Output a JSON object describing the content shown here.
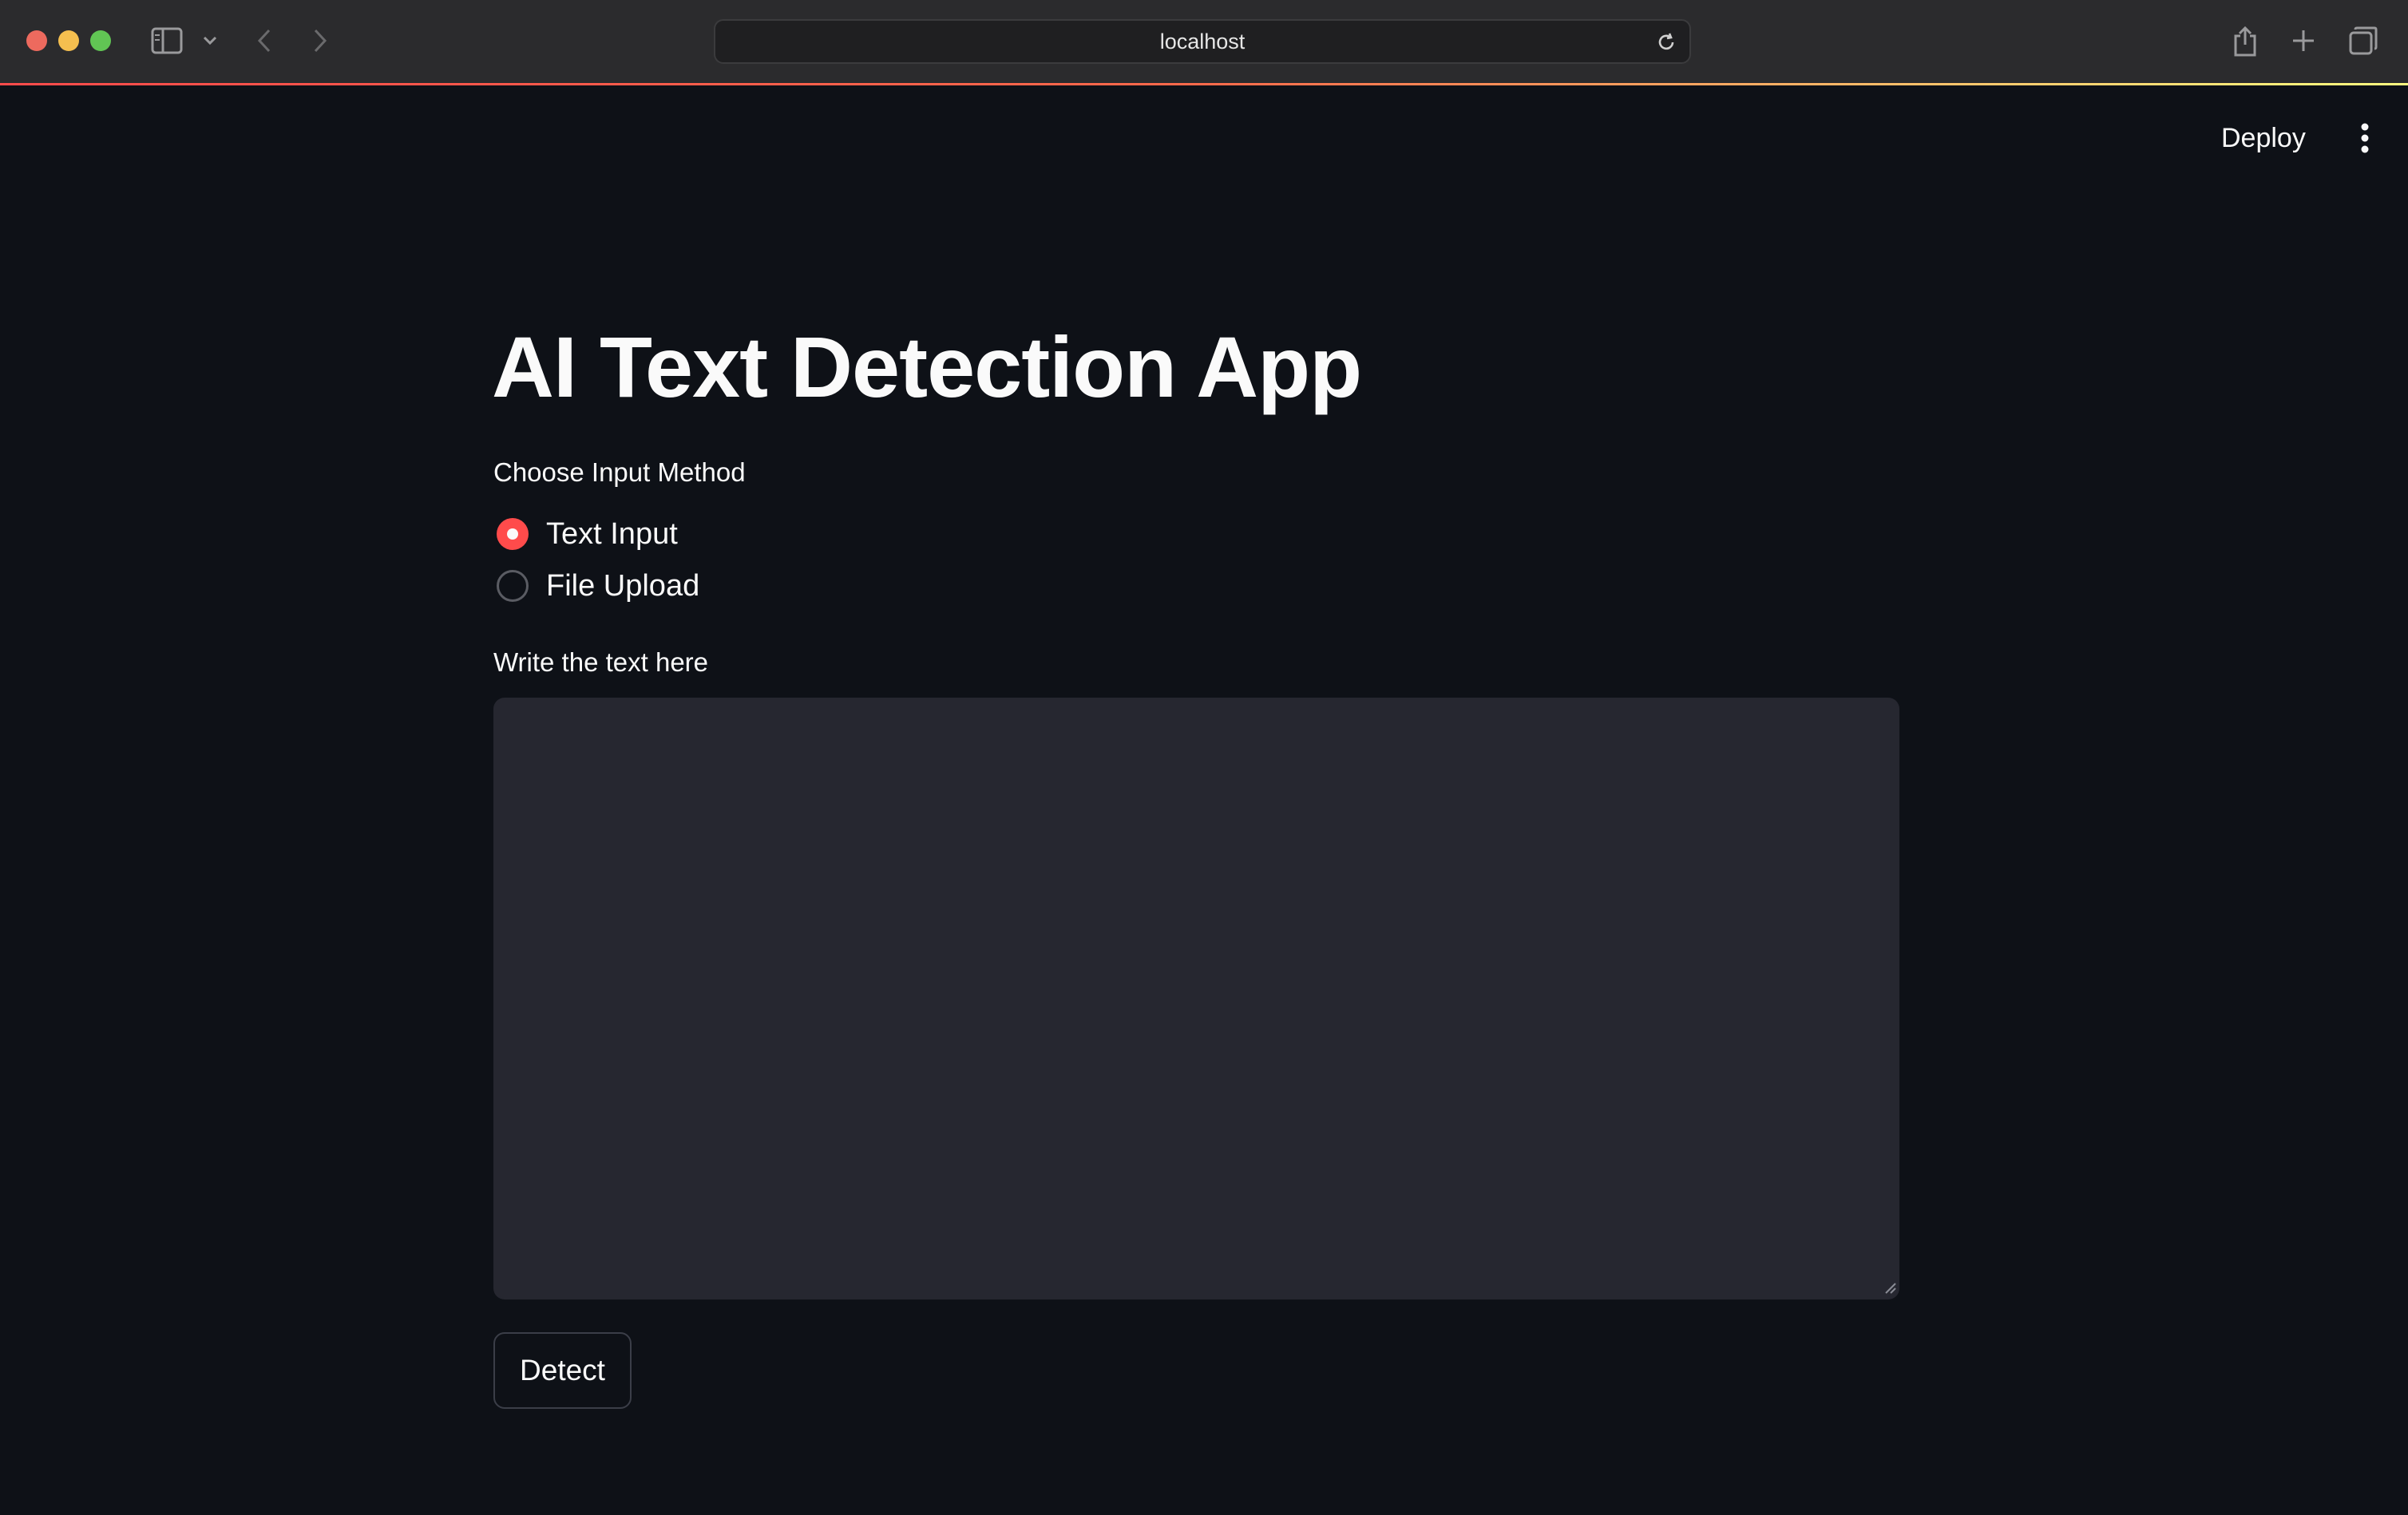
{
  "browser": {
    "url": "localhost",
    "icons": [
      "sidebar-icon",
      "chevron-down-icon",
      "back-icon",
      "forward-icon",
      "reload-icon",
      "share-icon",
      "new-tab-icon",
      "tabs-overview-icon"
    ]
  },
  "header": {
    "deploy_label": "Deploy",
    "menu_icon": "vertical-ellipsis-icon"
  },
  "main": {
    "title": "AI Text Detection App",
    "input_method_label": "Choose Input Method",
    "radio_options": [
      {
        "label": "Text Input",
        "selected": true
      },
      {
        "label": "File Upload",
        "selected": false
      }
    ],
    "textarea_label": "Write the text here",
    "textarea_value": "",
    "detect_button_label": "Detect"
  },
  "colors": {
    "background": "#0e1117",
    "accent": "#ff4b4b",
    "textarea_bg": "#262730",
    "text": "#fafafa"
  }
}
